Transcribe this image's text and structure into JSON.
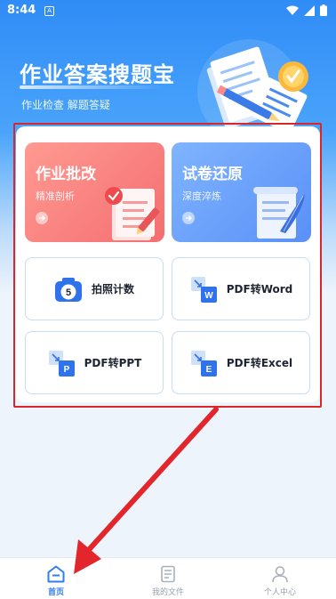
{
  "status": {
    "time": "8:44",
    "notif_glyph": "A"
  },
  "header": {
    "title": "作业答案搜题宝",
    "subtitle": "作业检查  解题答疑"
  },
  "cards": {
    "grading": {
      "title": "作业批改",
      "subtitle": "精准剖析"
    },
    "restore": {
      "title": "试卷还原",
      "subtitle": "深度淬炼"
    },
    "photo_count": {
      "label": "拍照计数",
      "icon_text": "5"
    },
    "pdf_word": {
      "label": "PDF转Word",
      "icon_text": "W"
    },
    "pdf_ppt": {
      "label": "PDF转PPT",
      "icon_text": "P"
    },
    "pdf_excel": {
      "label": "PDF转Excel",
      "icon_text": "E"
    }
  },
  "nav": {
    "home": "首页",
    "files": "我的文件",
    "profile": "个人中心"
  },
  "colors": {
    "accent": "#2f7ef3",
    "highlight": "#d8262b",
    "grading_card": "#f46e71",
    "restore_card": "#5a90f7"
  }
}
